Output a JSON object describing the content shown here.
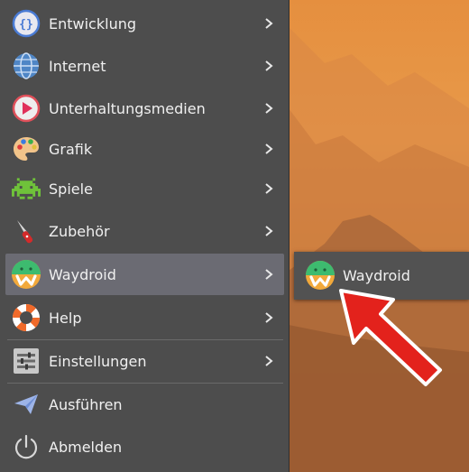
{
  "menu": {
    "items": [
      {
        "label": "Entwicklung",
        "icon": "development-icon"
      },
      {
        "label": "Internet",
        "icon": "globe-icon"
      },
      {
        "label": "Unterhaltungsmedien",
        "icon": "media-play-icon"
      },
      {
        "label": "Grafik",
        "icon": "palette-icon"
      },
      {
        "label": "Spiele",
        "icon": "invader-icon"
      },
      {
        "label": "Zubehör",
        "icon": "pocket-knife-icon"
      },
      {
        "label": "Waydroid",
        "icon": "waydroid-icon",
        "active": true
      },
      {
        "label": "Help",
        "icon": "lifebuoy-icon"
      },
      {
        "label": "Einstellungen",
        "icon": "settings-icon"
      },
      {
        "label": "Ausführen",
        "icon": "paper-plane-icon"
      },
      {
        "label": "Abmelden",
        "icon": "power-icon"
      }
    ]
  },
  "submenu": {
    "items": [
      {
        "label": "Waydroid",
        "icon": "waydroid-icon"
      }
    ]
  },
  "colors": {
    "menu_bg": "#4d4d4d",
    "active_bg": "#6b6b73",
    "arrow": "#e3221c"
  }
}
